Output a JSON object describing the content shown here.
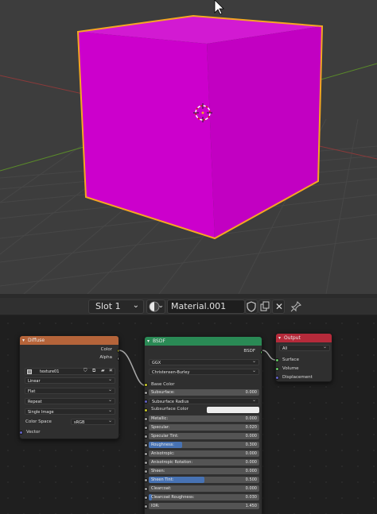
{
  "colors": {
    "viewport_bg": "#3d3d3d",
    "cube_face": "#cc00cc",
    "cube_outline": "#f5a623",
    "diffuse_header": "#b5643a",
    "bsdf_header": "#2a8a55",
    "output_header": "#b52a3a",
    "slider_fill": "#4772b3"
  },
  "header": {
    "slot": "Slot 1",
    "material_name": "Material.001"
  },
  "diffuse": {
    "title": "Diffuse",
    "outputs": [
      "Color",
      "Alpha"
    ],
    "image": "texture01",
    "interpolation": "Linear",
    "projection": "Flat",
    "extension": "Repeat",
    "source": "Single Image",
    "color_space_label": "Color Space",
    "color_space": "sRGB",
    "vector": "Vector"
  },
  "bsdf": {
    "title": "BSDF",
    "output": "BSDF",
    "distribution": "GGX",
    "subsurface_method": "Christensen-Burley",
    "base_color": "Base Color",
    "subsurface": {
      "label": "Subsurface:",
      "value": "0.000"
    },
    "subsurface_radius": "Subsurface Radius",
    "subsurface_color": "Subsurface Color",
    "sliders": [
      {
        "label": "Metallic:",
        "value": "0.000",
        "fill": 0
      },
      {
        "label": "Specular:",
        "value": "0.020",
        "fill": 0
      },
      {
        "label": "Specular Tint:",
        "value": "0.000",
        "fill": 0
      },
      {
        "label": "Roughness:",
        "value": "0.300",
        "fill": 0.3
      },
      {
        "label": "Anisotropic:",
        "value": "0.000",
        "fill": 0
      },
      {
        "label": "Anisotropic Rotation:",
        "value": "0.000",
        "fill": 0
      },
      {
        "label": "Sheen:",
        "value": "0.000",
        "fill": 0
      },
      {
        "label": "Sheen Tint:",
        "value": "0.500",
        "fill": 0.5
      },
      {
        "label": "Clearcoat:",
        "value": "0.000",
        "fill": 0
      },
      {
        "label": "Clearcoat Roughness:",
        "value": "0.030",
        "fill": 0.03
      },
      {
        "label": "IOR:",
        "value": "1.450",
        "fill": 0
      }
    ]
  },
  "output": {
    "title": "Output",
    "target": "All",
    "inputs": [
      "Surface",
      "Volume",
      "Displacement"
    ]
  }
}
